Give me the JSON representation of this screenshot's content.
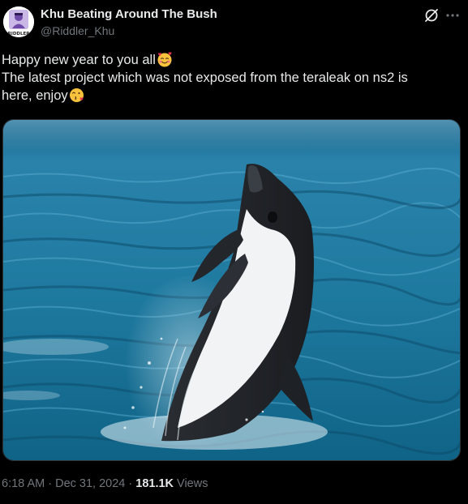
{
  "author": {
    "display_name": "Khu Beating Around The Bush",
    "handle": "@Riddler_Khu",
    "avatar_text": "RIDDLER"
  },
  "post": {
    "line1": "Happy new year to you all",
    "line2": "The latest project which was not exposed from the teraleak on ns2 is",
    "line3": "here, enjoy",
    "emoji1": "smiling-face-with-hearts",
    "emoji2": "face-blowing-a-kiss"
  },
  "media": {
    "alt": "Dolphin leaping out of the water"
  },
  "meta": {
    "time": "6:18 AM",
    "separator1": " · ",
    "date": "Dec 31, 2024",
    "separator2": " · ",
    "views_count": "181.1K",
    "views_label": " Views"
  },
  "colors": {
    "background": "#000000",
    "text_primary": "#e7e9ea",
    "text_secondary": "#71767b",
    "border": "#2f3336"
  },
  "icons": [
    "grok-icon",
    "more-icon"
  ]
}
